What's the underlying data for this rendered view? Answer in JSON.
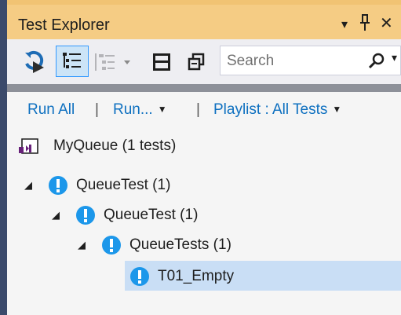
{
  "window": {
    "title": "Test Explorer",
    "dropdown_glyph": "▾",
    "pin_glyph": "ᛘ",
    "close_glyph": "✕"
  },
  "toolbar": {
    "search_placeholder": "Search",
    "search_dropdown_glyph": "▾",
    "icons": [
      "refresh-icon",
      "hierarchy-view-icon",
      "group-by-icon",
      "expand-all-icon",
      "copy-icon",
      "search-icon"
    ]
  },
  "actions": {
    "run_all": "Run All",
    "run": "Run...",
    "playlist": "Playlist : All Tests",
    "caret": "▼",
    "pipe": "|"
  },
  "tree": {
    "expanded_glyph": "◢",
    "project": {
      "label": "MyQueue (1 tests)"
    },
    "level1": {
      "label": "QueueTest (1)"
    },
    "level2": {
      "label": "QueueTest (1)"
    },
    "level3": {
      "label": "QueueTests (1)"
    },
    "test": {
      "label": "T01_Empty",
      "status": "not-run"
    }
  },
  "colors": {
    "title_bar": "#f5cc84",
    "link": "#0e70c0",
    "status_icon": "#1c97ea",
    "selection": "#c9def5"
  }
}
